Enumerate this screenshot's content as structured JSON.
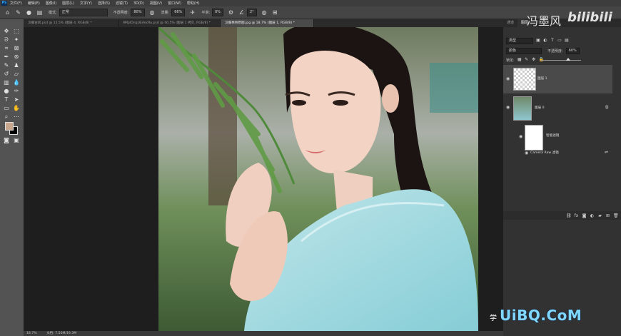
{
  "menubar": {
    "items": [
      "文件(F)",
      "编辑(E)",
      "图像(I)",
      "图层(L)",
      "文字(Y)",
      "选择(S)",
      "滤镜(T)",
      "3D(D)",
      "视图(V)",
      "窗口(W)",
      "帮助(H)"
    ],
    "logo": "Ps"
  },
  "options_bar": {
    "mode_label": "模式:",
    "mode_value": "正常",
    "opacity_label": "不透明度:",
    "opacity_value": "80%",
    "flow_label": "流量:",
    "flow_value": "66%",
    "smoothing_label": "平滑:",
    "smoothing_value": "0%",
    "angle_value": "2°"
  },
  "tabs": [
    {
      "label": "汉服古风.psd @ 12.5% (图层 4, RGB/8) *",
      "active": false
    },
    {
      "label": "9MpIOnqUEAecRo.psd @ 40.5% (图层 1 拷贝, RGB/8) *",
      "active": false
    },
    {
      "label": "汉服林林原图.jpg @ 18.7% (图层 1, RGB/8) *",
      "active": true
    }
  ],
  "layers_panel": {
    "tabs": [
      "通道",
      "图层"
    ],
    "filter_kind": "类型",
    "blend_mode": "颜色",
    "opacity_label": "不透明度:",
    "opacity_value": "60%",
    "lock_label": "锁定:",
    "fill_label": "填充:",
    "layers": [
      {
        "name": "图层 1",
        "selected": true
      },
      {
        "name": "图层 0",
        "selected": false
      },
      {
        "name": "智能滤镜",
        "selected": false
      },
      {
        "name": "Camera Raw 滤镜",
        "selected": false
      }
    ]
  },
  "status": {
    "zoom": "18.7%",
    "doc": "文档: 7.56M/19.3M"
  },
  "watermarks": {
    "top": "冯墨风",
    "bilibili": "bilibili",
    "bottom": "学",
    "uibq": "UiBQ.CoM"
  },
  "colors": {
    "foreground": "#c8a78e",
    "background": "#000000"
  }
}
